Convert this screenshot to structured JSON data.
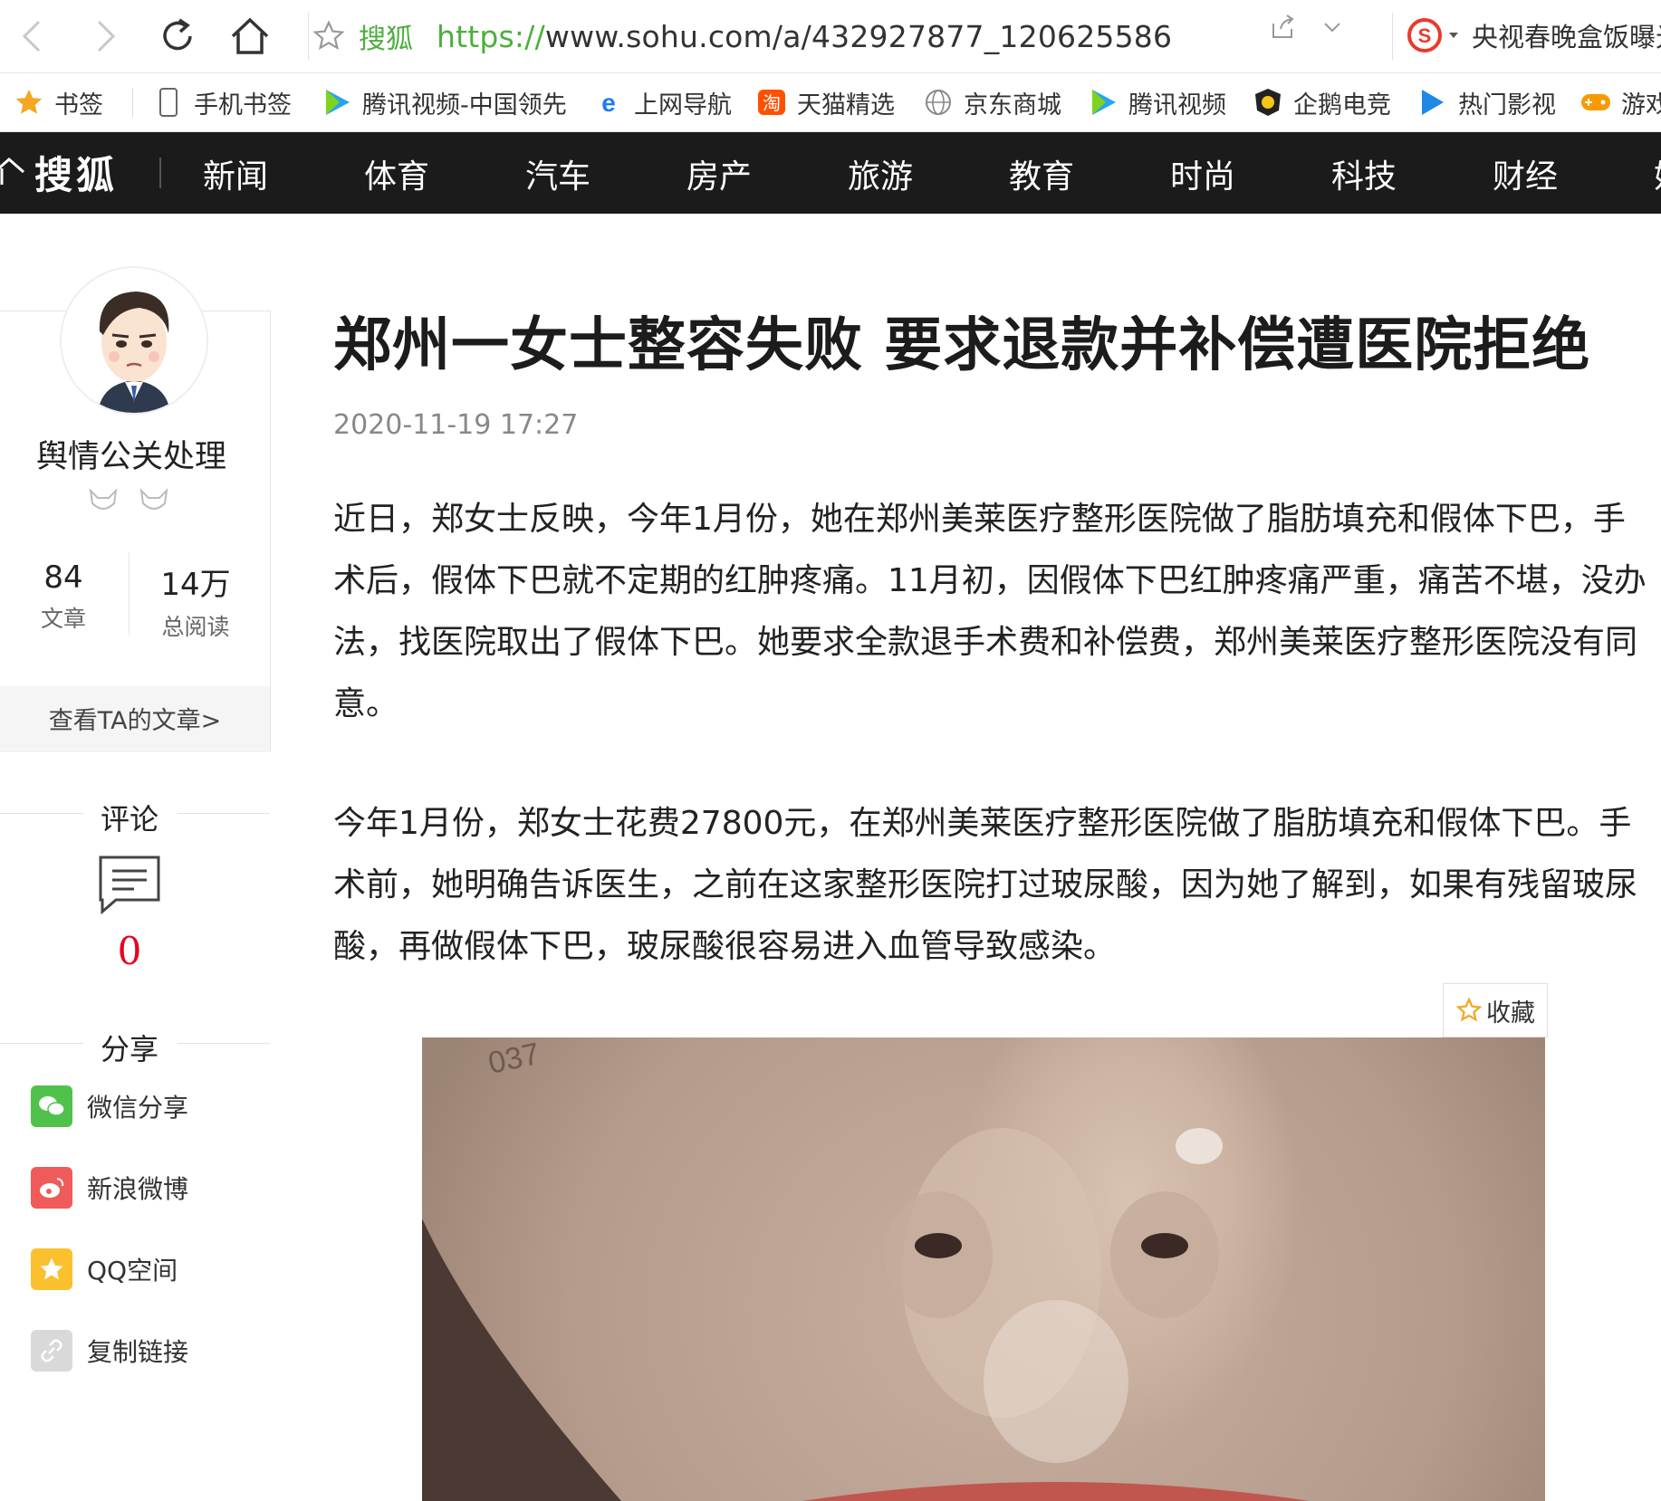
{
  "browser": {
    "site_name": "搜狐",
    "url_protocol": "https://",
    "url_rest": "www.sohu.com/a/432927877_120625586",
    "search_text": "央视春晚盒饭曝光"
  },
  "bookmarks": [
    {
      "label": "书签"
    },
    {
      "label": "手机书签"
    },
    {
      "label": "腾讯视频-中国领先"
    },
    {
      "label": "上网导航"
    },
    {
      "label": "天猫精选"
    },
    {
      "label": "京东商城"
    },
    {
      "label": "腾讯视频"
    },
    {
      "label": "企鹅电竞"
    },
    {
      "label": "热门影视"
    },
    {
      "label": "游戏"
    }
  ],
  "sohu_nav": {
    "logo": "搜狐",
    "items": [
      "新闻",
      "体育",
      "汽车",
      "房产",
      "旅游",
      "教育",
      "时尚",
      "科技",
      "财经",
      "娱"
    ]
  },
  "author": {
    "name": "舆情公关处理",
    "articles_count": "84",
    "articles_label": "文章",
    "reads_count": "14万",
    "reads_label": "总阅读",
    "view_articles": "查看TA的文章>"
  },
  "comments": {
    "title": "评论",
    "count": "0"
  },
  "share": {
    "title": "分享",
    "items": [
      "微信分享",
      "新浪微博",
      "QQ空间",
      "复制链接"
    ]
  },
  "article": {
    "title": "郑州一女士整容失败 要求退款并补偿遭医院拒绝",
    "date": "2020-11-19 17:27",
    "paragraphs": [
      "近日，郑女士反映，今年1月份，她在郑州美莱医疗整形医院做了脂肪填充和假体下巴，手术后，假体下巴就不定期的红肿疼痛。11月初，因假体下巴红肿疼痛严重，痛苦不堪，没办法，找医院取出了假体下巴。她要求全款退手术费和补偿费，郑州美莱医疗整形医院没有同意。",
      "今年1月份，郑女士花费27800元，在郑州美莱医疗整形医院做了脂肪填充和假体下巴。手术前，她明确告诉医生，之前在这家整形医院打过玻尿酸，因为她了解到，如果有残留玻尿酸，再做假体下巴，玻尿酸很容易进入血管导致感染。"
    ],
    "collect_label": "收藏",
    "photo_stamp": "037"
  }
}
